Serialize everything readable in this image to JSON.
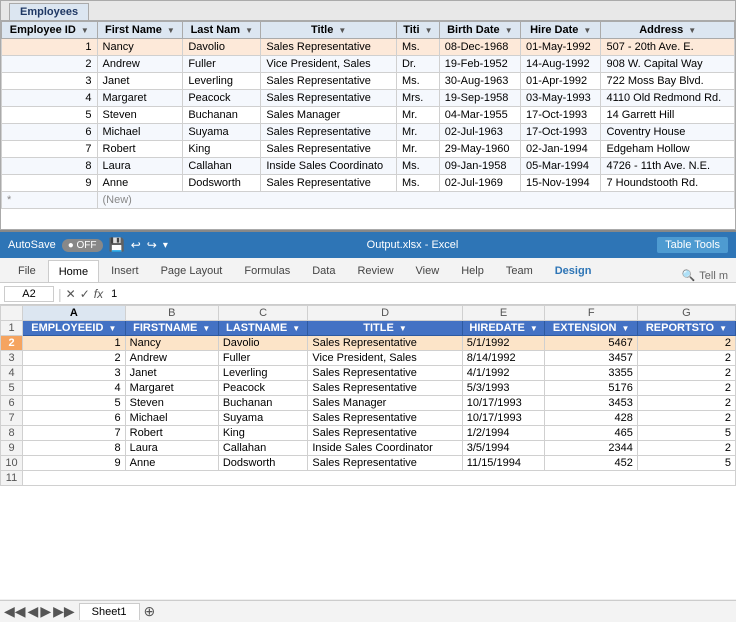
{
  "access": {
    "tab_label": "Employees",
    "columns": [
      {
        "id": "employee_id",
        "label": "Employee ID",
        "sortable": true
      },
      {
        "id": "first_name",
        "label": "First Name",
        "sortable": true
      },
      {
        "id": "last_name",
        "label": "Last Nam",
        "sortable": true
      },
      {
        "id": "title",
        "label": "Title",
        "sortable": true
      },
      {
        "id": "titi",
        "label": "Titi",
        "sortable": true
      },
      {
        "id": "birth_date",
        "label": "Birth Date",
        "sortable": true
      },
      {
        "id": "hire_date",
        "label": "Hire Date",
        "sortable": true
      },
      {
        "id": "address",
        "label": "Address",
        "sortable": true
      }
    ],
    "rows": [
      {
        "num": "1",
        "first": "Nancy",
        "last": "Davolio",
        "title": "Sales Representative",
        "titi": "Ms.",
        "birth": "08-Dec-1968",
        "hire": "01-May-1992",
        "address": "507 - 20th Ave. E.",
        "selected": true
      },
      {
        "num": "2",
        "first": "Andrew",
        "last": "Fuller",
        "title": "Vice President, Sales",
        "titi": "Dr.",
        "birth": "19-Feb-1952",
        "hire": "14-Aug-1992",
        "address": "908 W. Capital Way"
      },
      {
        "num": "3",
        "first": "Janet",
        "last": "Leverling",
        "title": "Sales Representative",
        "titi": "Ms.",
        "birth": "30-Aug-1963",
        "hire": "01-Apr-1992",
        "address": "722 Moss Bay Blvd."
      },
      {
        "num": "4",
        "first": "Margaret",
        "last": "Peacock",
        "title": "Sales Representative",
        "titi": "Mrs.",
        "birth": "19-Sep-1958",
        "hire": "03-May-1993",
        "address": "4110 Old Redmond Rd."
      },
      {
        "num": "5",
        "first": "Steven",
        "last": "Buchanan",
        "title": "Sales Manager",
        "titi": "Mr.",
        "birth": "04-Mar-1955",
        "hire": "17-Oct-1993",
        "address": "14 Garrett Hill"
      },
      {
        "num": "6",
        "first": "Michael",
        "last": "Suyama",
        "title": "Sales Representative",
        "titi": "Mr.",
        "birth": "02-Jul-1963",
        "hire": "17-Oct-1993",
        "address": "Coventry House"
      },
      {
        "num": "7",
        "first": "Robert",
        "last": "King",
        "title": "Sales Representative",
        "titi": "Mr.",
        "birth": "29-May-1960",
        "hire": "02-Jan-1994",
        "address": "Edgeham Hollow"
      },
      {
        "num": "8",
        "first": "Laura",
        "last": "Callahan",
        "title": "Inside Sales Coordinato",
        "titi": "Ms.",
        "birth": "09-Jan-1958",
        "hire": "05-Mar-1994",
        "address": "4726 - 11th Ave. N.E."
      },
      {
        "num": "9",
        "first": "Anne",
        "last": "Dodsworth",
        "title": "Sales Representative",
        "titi": "Ms.",
        "birth": "02-Jul-1969",
        "hire": "15-Nov-1994",
        "address": "7 Houndstooth Rd."
      }
    ],
    "new_row_label": "(New)"
  },
  "excel": {
    "autosave_label": "AutoSave",
    "title": "Output.xlsx - Excel",
    "table_tools_label": "Table Tools",
    "ribbon_tabs": [
      "File",
      "Home",
      "Insert",
      "Page Layout",
      "Formulas",
      "Data",
      "Review",
      "View",
      "Help",
      "Team",
      "Design",
      "Tell m"
    ],
    "active_tab": "Home",
    "design_tab": "Design",
    "cell_ref": "A2",
    "formula_value": "1",
    "col_headers": [
      "A",
      "B",
      "C",
      "D",
      "E",
      "F",
      "G"
    ],
    "sheet_col_headers": [
      "EMPLOYEEID",
      "FIRSTNAME",
      "LASTNAME",
      "TITLE",
      "HIREDATE",
      "EXTENSION",
      "REPORTSTO"
    ],
    "rows": [
      {
        "num": "2",
        "a": "1",
        "b": "Nancy",
        "c": "Davolio",
        "d": "Sales Representative",
        "e": "5/1/1992",
        "f": "5467",
        "g": "2",
        "selected": true
      },
      {
        "num": "3",
        "a": "2",
        "b": "Andrew",
        "c": "Fuller",
        "d": "Vice President, Sales",
        "e": "8/14/1992",
        "f": "3457",
        "g": "2"
      },
      {
        "num": "4",
        "a": "3",
        "b": "Janet",
        "c": "Leverling",
        "d": "Sales Representative",
        "e": "4/1/1992",
        "f": "3355",
        "g": "2"
      },
      {
        "num": "5",
        "a": "4",
        "b": "Margaret",
        "c": "Peacock",
        "d": "Sales Representative",
        "e": "5/3/1993",
        "f": "5176",
        "g": "2"
      },
      {
        "num": "6",
        "a": "5",
        "b": "Steven",
        "c": "Buchanan",
        "d": "Sales Manager",
        "e": "10/17/1993",
        "f": "3453",
        "g": "2"
      },
      {
        "num": "7",
        "a": "6",
        "b": "Michael",
        "c": "Suyama",
        "d": "Sales Representative",
        "e": "10/17/1993",
        "f": "428",
        "g": "2"
      },
      {
        "num": "8",
        "a": "7",
        "b": "Robert",
        "c": "King",
        "d": "Sales Representative",
        "e": "1/2/1994",
        "f": "465",
        "g": "5"
      },
      {
        "num": "9",
        "a": "8",
        "b": "Laura",
        "c": "Callahan",
        "d": "Inside Sales Coordinator",
        "e": "3/5/1994",
        "f": "2344",
        "g": "2"
      },
      {
        "num": "10",
        "a": "9",
        "b": "Anne",
        "c": "Dodsworth",
        "d": "Sales Representative",
        "e": "11/15/1994",
        "f": "452",
        "g": "5"
      }
    ],
    "empty_row": "11",
    "sheet_tab": "Sheet1"
  }
}
